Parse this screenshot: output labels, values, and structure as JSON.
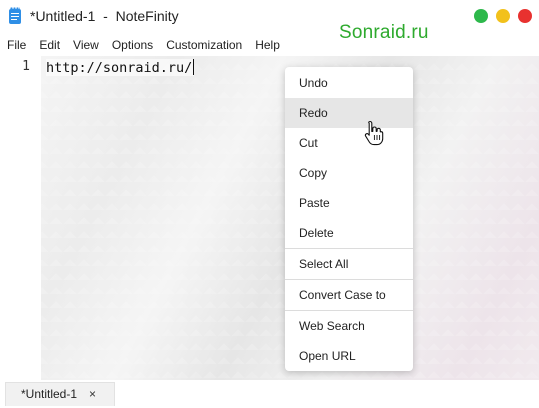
{
  "titlebar": {
    "title": "*Untitled-1  -  NoteFinity",
    "watermark": "Sonraid.ru",
    "window_buttons": [
      "green",
      "yellow",
      "red"
    ],
    "colors": {
      "green": "#2db84b",
      "yellow": "#f2c11b",
      "red": "#e8312f",
      "watermark": "#2eaa2e"
    }
  },
  "menubar": {
    "items": [
      "File",
      "Edit",
      "View",
      "Options",
      "Customization",
      "Help"
    ]
  },
  "editor": {
    "line_number": "1",
    "text": "http://sonraid.ru/"
  },
  "context_menu": {
    "items": [
      "Undo",
      "Redo",
      "Cut",
      "Copy",
      "Paste",
      "Delete",
      "Select All",
      "Convert Case to",
      "Web Search",
      "Open URL"
    ],
    "hovered": "Redo"
  },
  "tabs": {
    "items": [
      {
        "label": "*Untitled-1",
        "close": "×"
      }
    ]
  }
}
